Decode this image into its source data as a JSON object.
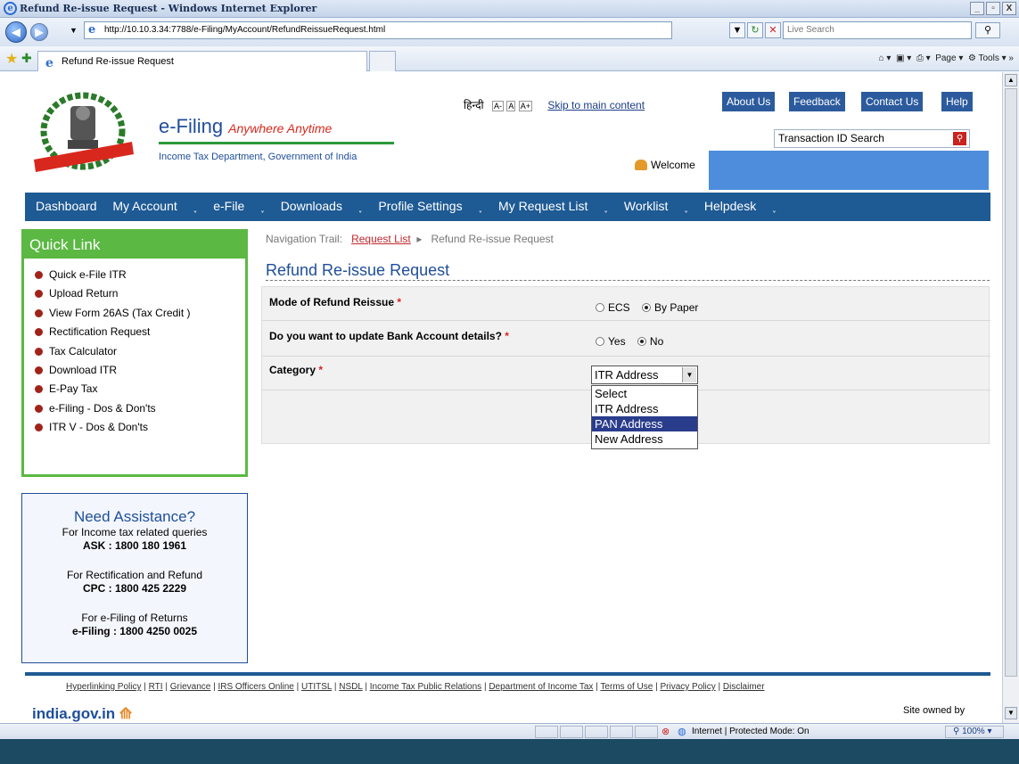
{
  "window": {
    "title": "Refund Re-issue Request - Windows Internet Explorer",
    "url": "http://10.10.3.34:7788/e-Filing/MyAccount/RefundReissueRequest.html",
    "live_search_placeholder": "Live Search",
    "tab_title": "Refund Re-issue Request",
    "cmd": {
      "page": "Page",
      "tools": "Tools"
    },
    "controls": {
      "min": "_",
      "max": "▫",
      "close": "X"
    }
  },
  "header": {
    "brand": "e-Filing",
    "tagline": "Anywhere Anytime",
    "dept": "Income Tax Department, Government of India",
    "lang_hindi": "हिन्दी",
    "font_sizes": [
      "A-",
      "A",
      "A+"
    ],
    "skip_link": "Skip to main content",
    "top_buttons": [
      "About Us",
      "Feedback",
      "Contact Us",
      "Help"
    ],
    "tx_search": "Transaction ID Search",
    "welcome": "Welcome"
  },
  "nav": [
    "Dashboard",
    "My Account",
    "e-File",
    "Downloads",
    "Profile Settings",
    "My Request List",
    "Worklist",
    "Helpdesk"
  ],
  "quick_link": {
    "title": "Quick Link",
    "items": [
      "Quick e-File ITR",
      "Upload Return",
      "View Form 26AS (Tax Credit )",
      "Rectification Request",
      "Tax Calculator",
      "Download ITR",
      "E-Pay Tax",
      "e-Filing - Dos & Don'ts",
      "ITR V - Dos & Don'ts"
    ]
  },
  "assist": {
    "title": "Need Assistance?",
    "l1": "For Income tax related queries",
    "l1b": "ASK : 1800 180 1961",
    "l2": "For Rectification and Refund",
    "l2b": "CPC : 1800 425 2229",
    "l3": "For e-Filing of Returns",
    "l3b": "e-Filing : 1800 4250 0025"
  },
  "trail": {
    "label": "Navigation Trail:",
    "link": "Request List",
    "current": "Refund Re-issue Request"
  },
  "content_title": "Refund Re-issue Request",
  "form": {
    "mode_label": "Mode of Refund Reissue",
    "mode_opts": [
      "ECS",
      "By Paper"
    ],
    "mode_selected": "By Paper",
    "bank_label": "Do you want to update Bank Account details?",
    "bank_opts": [
      "Yes",
      "No"
    ],
    "bank_selected": "No",
    "category_label": "Category",
    "required": "*",
    "category_value": "ITR Address",
    "category_options": [
      "Select",
      "ITR Address",
      "PAN Address",
      "New Address"
    ],
    "category_highlight": "PAN Address"
  },
  "footer": {
    "links": [
      "Hyperlinking Policy",
      "RTI",
      "Grievance",
      "IRS Officers Online",
      "UTITSL",
      "NSDL",
      "Income Tax Public Relations",
      "Department of Income Tax",
      "Terms of Use",
      "Privacy Policy",
      "Disclaimer"
    ],
    "india_gov": "india.gov.in",
    "site_owned": "Site owned by"
  },
  "status": {
    "zone": "Internet | Protected Mode: On",
    "zoom": "100%"
  }
}
